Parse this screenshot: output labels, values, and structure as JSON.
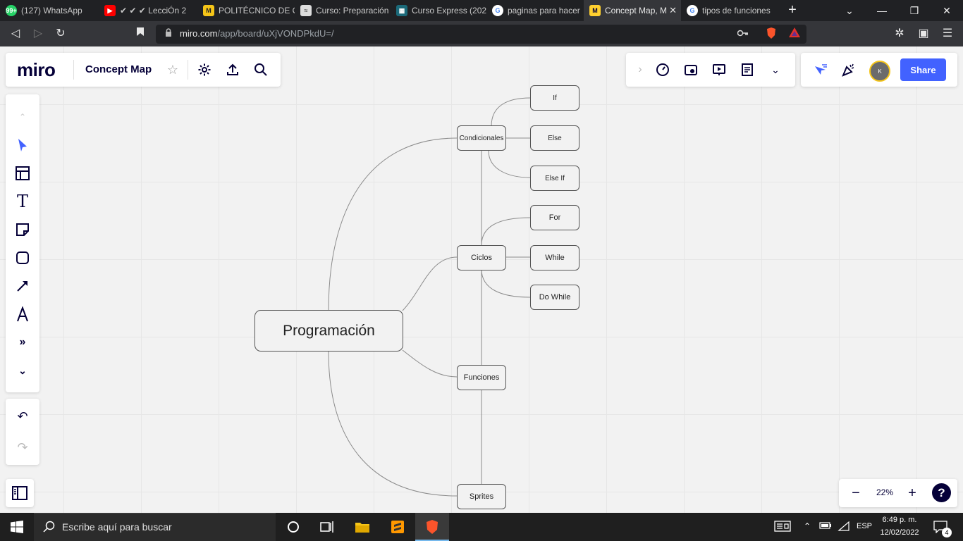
{
  "browser": {
    "tabs": [
      {
        "title": "(127) WhatsApp",
        "color": "#25d366",
        "glyph": "99+"
      },
      {
        "title": "✔ ✔ ✔ LecciÓn 2",
        "color": "#ff0000",
        "glyph": "▶"
      },
      {
        "title": "POLITÉCNICO DE C",
        "color": "#f5c518",
        "glyph": "M"
      },
      {
        "title": "Curso: Preparación",
        "color": "#dddddd",
        "glyph": "≈"
      },
      {
        "title": "Curso Express (202",
        "color": "#1b6a7a",
        "glyph": "▦"
      },
      {
        "title": "paginas para hacer",
        "color": "#ffffff",
        "glyph": "G"
      },
      {
        "title": "Concept Map, M",
        "color": "#ffd02f",
        "glyph": "M"
      },
      {
        "title": "tipos de funciones",
        "color": "#ffffff",
        "glyph": "G"
      }
    ],
    "active_tab": 6,
    "url_host": "miro.com",
    "url_path": "/app/board/uXjVONDPkdU=/"
  },
  "miro": {
    "logo": "miro",
    "board_name": "Concept Map",
    "share_label": "Share",
    "avatar_initial": "K",
    "zoom": "22%",
    "help": "?"
  },
  "mindmap": {
    "root": "Programación",
    "condicionales": "Condicionales",
    "if": "If",
    "else": "Else",
    "elseif": "Else If",
    "ciclos": "Ciclos",
    "for": "For",
    "while": "While",
    "dowhile": "Do While",
    "funciones": "Funciones",
    "sprites": "Sprites"
  },
  "taskbar": {
    "search_placeholder": "Escribe aquí para buscar",
    "lang": "ESP",
    "time": "6:49 p. m.",
    "date": "12/02/2022",
    "notifications": "4"
  }
}
